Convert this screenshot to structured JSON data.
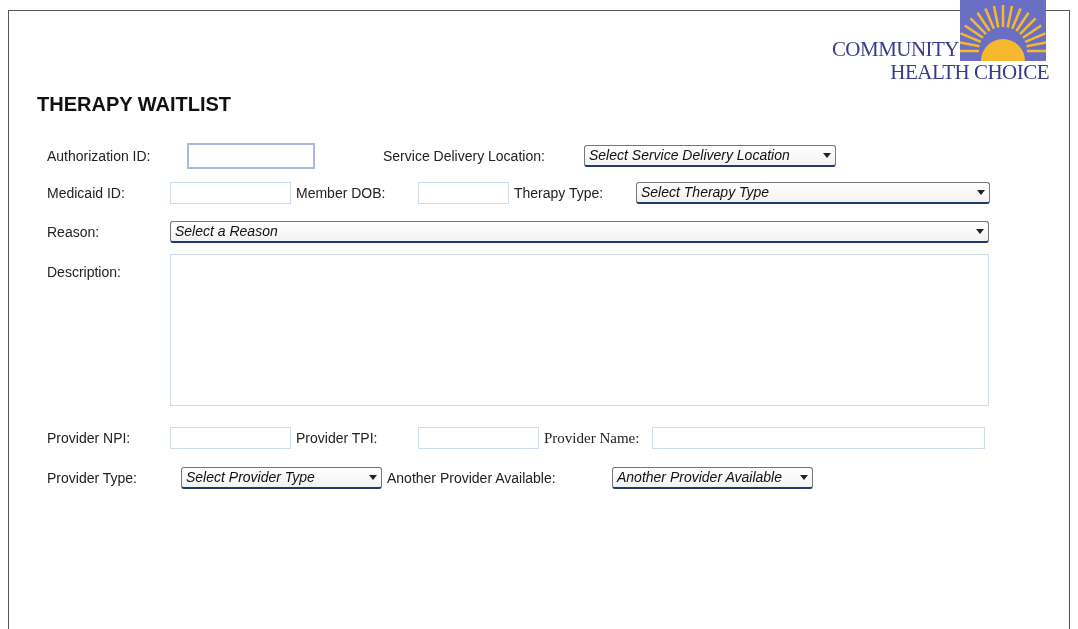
{
  "logo": {
    "line_1": "COMMUNITY",
    "line_2": "HEALTH CHOICE"
  },
  "title": "THERAPY WAITLIST",
  "authorization_id": {
    "label": "Authorization ID:"
  },
  "service_delivery_location": {
    "label": "Service Delivery Location:",
    "value": "Select Service Delivery Location"
  },
  "medicaid_id": {
    "label": "Medicaid ID:"
  },
  "member_dob": {
    "label": "Member DOB:"
  },
  "therapy_type": {
    "label": "Therapy Type:",
    "value": "Select Therapy Type"
  },
  "reason": {
    "label": "Reason:",
    "value": "Select a Reason"
  },
  "description": {
    "label": "Description:"
  },
  "provider_npi": {
    "label": "Provider NPI:"
  },
  "provider_tpi": {
    "label": "Provider TPI:"
  },
  "provider_name": {
    "label": "Provider Name:"
  },
  "provider_type": {
    "label": "Provider Type:",
    "value": "Select Provider Type"
  },
  "another_provider_available": {
    "label": "Another Provider Available:",
    "value": "Another Provider Available"
  }
}
